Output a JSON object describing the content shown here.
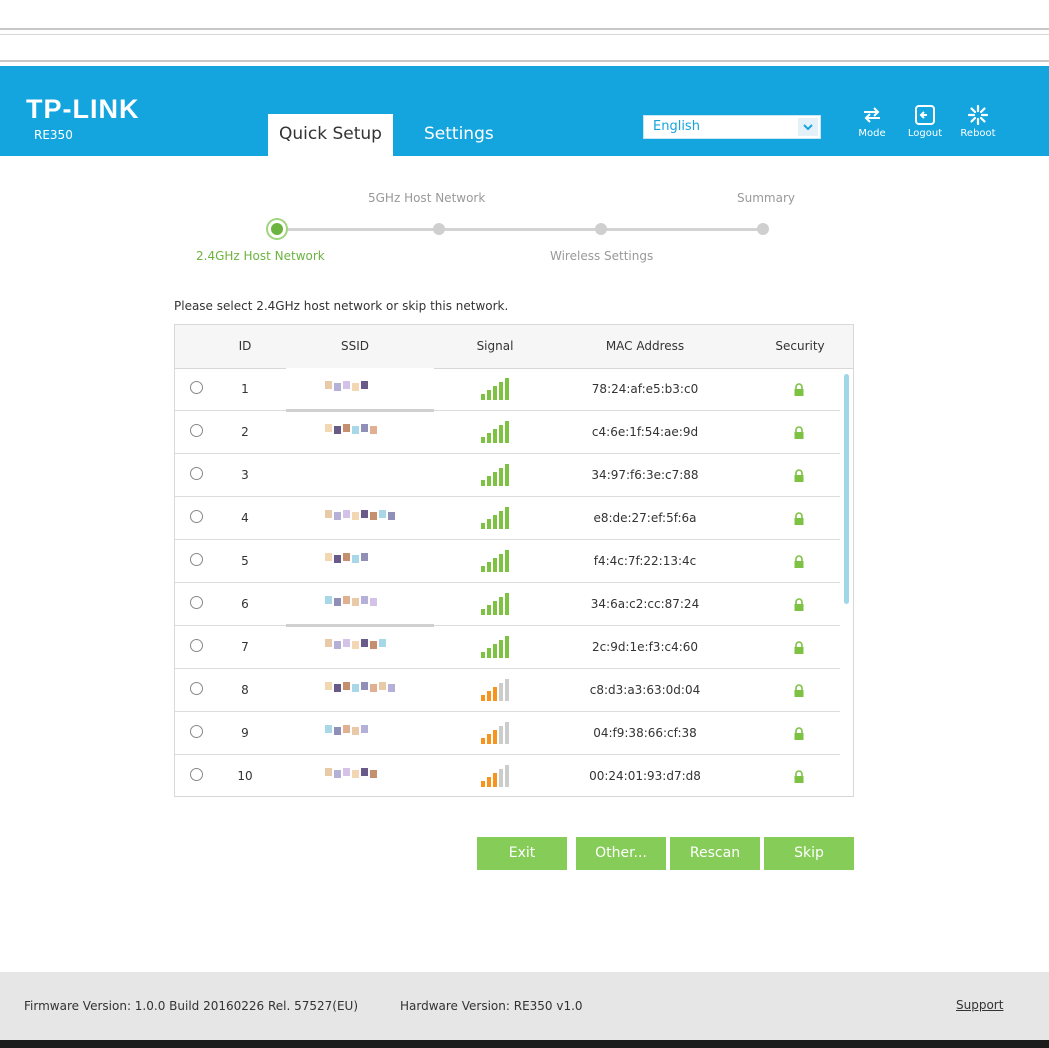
{
  "header": {
    "brand": "TP-LINK",
    "model": "RE350",
    "tabs": [
      {
        "label": "Quick Setup",
        "active": true
      },
      {
        "label": "Settings",
        "active": false
      }
    ],
    "language": {
      "selected": "English"
    },
    "buttons": [
      {
        "label": "Mode",
        "icon": "mode-icon"
      },
      {
        "label": "Logout",
        "icon": "logout-icon"
      },
      {
        "label": "Reboot",
        "icon": "reboot-icon"
      }
    ],
    "accent_color": "#14a5df"
  },
  "stepper": {
    "steps": [
      {
        "label": "2.4GHz Host Network",
        "status": "active"
      },
      {
        "label": "5GHz Host Network",
        "status": "pending"
      },
      {
        "label": "Wireless Settings",
        "status": "pending"
      },
      {
        "label": "Summary",
        "status": "pending"
      }
    ],
    "active_color": "#6db33f"
  },
  "instruction": "Please select 2.4GHz host network or skip this network.",
  "table": {
    "headers": [
      "ID",
      "SSID",
      "Signal",
      "MAC Address",
      "Security"
    ],
    "rows": [
      {
        "id": "1",
        "mac": "78:24:af:e5:b3:c0",
        "signal": 5
      },
      {
        "id": "2",
        "mac": "c4:6e:1f:54:ae:9d",
        "signal": 5
      },
      {
        "id": "3",
        "mac": "34:97:f6:3e:c7:88",
        "signal": 5
      },
      {
        "id": "4",
        "mac": "e8:de:27:ef:5f:6a",
        "signal": 5
      },
      {
        "id": "5",
        "mac": "f4:4c:7f:22:13:4c",
        "signal": 5
      },
      {
        "id": "6",
        "mac": "34:6a:c2:cc:87:24",
        "signal": 5
      },
      {
        "id": "7",
        "mac": "2c:9d:1e:f3:c4:60",
        "signal": 5
      },
      {
        "id": "8",
        "mac": "c8:d3:a3:63:0d:04",
        "signal": 3
      },
      {
        "id": "9",
        "mac": "04:f9:38:66:cf:38",
        "signal": 3
      },
      {
        "id": "10",
        "mac": "00:24:01:93:d7:d8",
        "signal": 3
      }
    ],
    "signal_colors": {
      "strong": "#7dc242",
      "medium": "#f7941d",
      "empty": "#cccccc"
    },
    "lock_color": "#7dc242"
  },
  "actions": {
    "exit": "Exit",
    "other": "Other...",
    "rescan": "Rescan",
    "skip": "Skip",
    "button_color": "#86cc58"
  },
  "footer": {
    "firmware": "Firmware Version: 1.0.0 Build 20160226 Rel. 57527(EU)",
    "hardware": "Hardware Version: RE350 v1.0",
    "support": "Support"
  }
}
